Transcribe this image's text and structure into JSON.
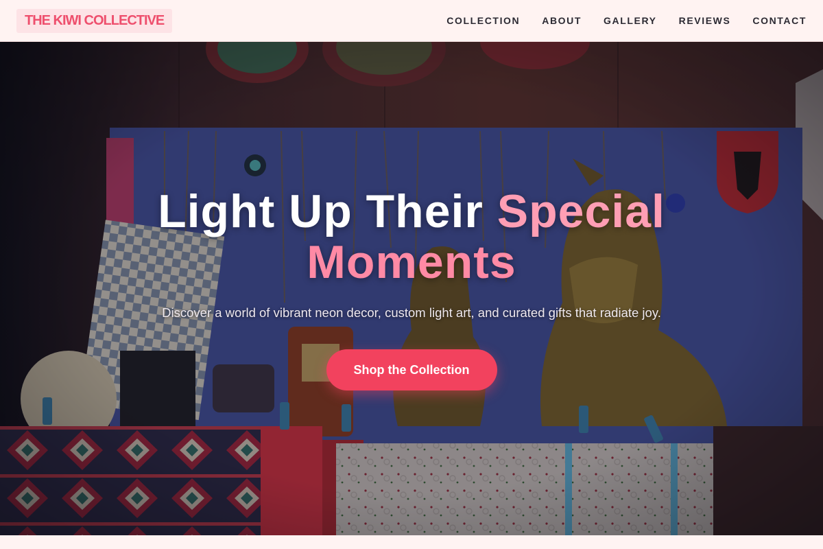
{
  "brand": {
    "name": "THE KIWI COLLECTIVE"
  },
  "nav": {
    "links": [
      "COLLECTION",
      "ABOUT",
      "GALLERY",
      "REVIEWS",
      "CONTACT"
    ]
  },
  "hero": {
    "title_part1": "Light Up Their ",
    "title_part2": "Special",
    "title_part3": "Moments",
    "subtitle": "Discover a world of vibrant neon decor, custom light art, and curated gifts that radiate joy.",
    "cta_label": "Shop the Collection"
  },
  "colors": {
    "accent": "#f2425e",
    "logo_text": "#ee4f6d",
    "page_bg": "#fff3f2"
  }
}
